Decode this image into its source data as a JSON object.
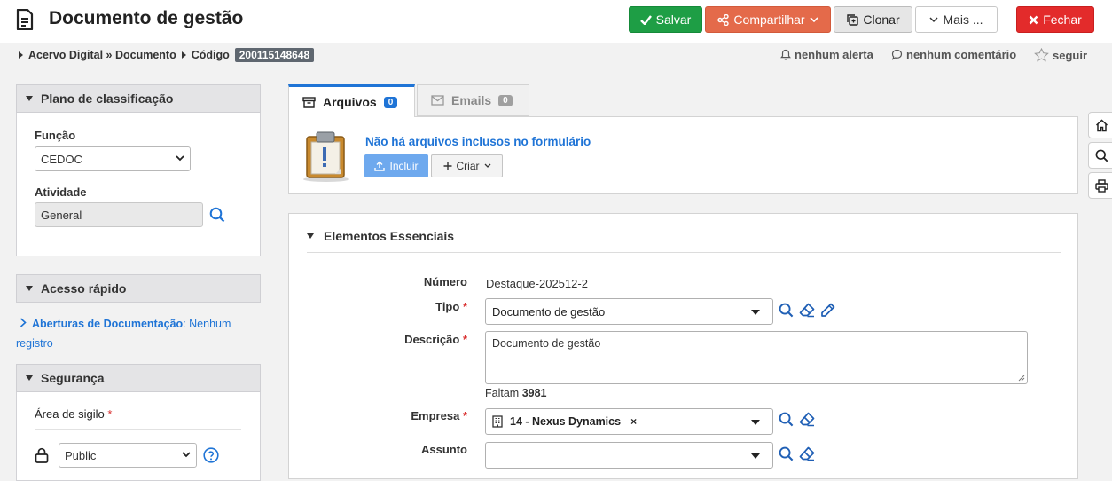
{
  "header": {
    "title": "Documento de gestão",
    "buttons": {
      "save": "Salvar",
      "share": "Compartilhar",
      "clone": "Clonar",
      "more": "Mais ...",
      "close": "Fechar"
    }
  },
  "breadcrumb": {
    "items": [
      "Acervo Digital » Documento",
      "Código"
    ],
    "code": "200115148648",
    "alerts": "nenhum alerta",
    "comments": "nenhum comentário",
    "follow": "seguir"
  },
  "sidebar": {
    "classification": {
      "title": "Plano de classificação",
      "function_label": "Função",
      "function_value": "CEDOC",
      "activity_label": "Atividade",
      "activity_value": "General"
    },
    "quick_access": {
      "title": "Acesso rápido",
      "link": "Aberturas de Documentação",
      "status": ": Nenhum registro"
    },
    "security": {
      "title": "Segurança",
      "area_label": "Área de sigilo",
      "area_value": "Public"
    }
  },
  "tabs": [
    {
      "label": "Arquivos",
      "count": "0"
    },
    {
      "label": "Emails",
      "count": "0"
    }
  ],
  "files": {
    "empty_message": "Não há arquivos inclusos no formulário",
    "include_label": "Incluir",
    "create_label": "Criar"
  },
  "essentials": {
    "title": "Elementos Essenciais",
    "numero_label": "Número",
    "numero_value": "Destaque-202512-2",
    "tipo_label": "Tipo",
    "tipo_value": "Documento de gestão",
    "descricao_label": "Descrição",
    "descricao_value": "Documento de gestão",
    "remaining_prefix": "Faltam",
    "remaining_count": "3981",
    "empresa_label": "Empresa",
    "empresa_value": "14 - Nexus Dynamics",
    "empresa_remove": "×",
    "assunto_label": "Assunto",
    "assunto_value": ""
  },
  "colors": {
    "save": "#1e9e45",
    "share": "#e46a4a",
    "close": "#e32b2b",
    "link": "#1f74d6",
    "code_badge": "#5f6770"
  }
}
